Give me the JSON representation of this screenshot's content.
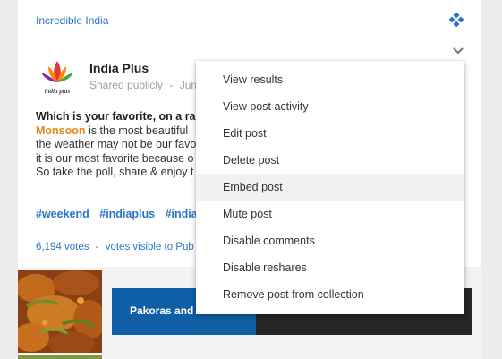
{
  "collection": {
    "name": "Incredible India",
    "icon": "diamond-dots-icon",
    "accent": "#2a76c6"
  },
  "post": {
    "author": "India Plus",
    "visibility": "Shared publicly",
    "separator": "-",
    "date": "Jun",
    "avatar_text": "india plus",
    "text": {
      "line1": "Which is your favorite, on a rain",
      "line2_bold": "Monsoon",
      "line2_rest": " is the most beautiful",
      "line3": "the weather may not be our favo",
      "line4": "it is our most favorite because o",
      "line5": "So take the poll, share & enjoy t"
    },
    "hashtags": [
      "#weekend",
      "#indiaplus",
      "#indian"
    ],
    "votes": "6,194 votes",
    "votes_separator": "-",
    "votes_visibility": "votes visible to Pub"
  },
  "poll": {
    "option_label": "Pakoras and b",
    "option_color": "#0f5fa6"
  },
  "menu": {
    "items": [
      "View results",
      "View post activity",
      "Edit post",
      "Delete post",
      "Embed post",
      "Mute post",
      "Disable comments",
      "Disable reshares",
      "Remove post from collection"
    ],
    "hovered": "Embed post"
  }
}
